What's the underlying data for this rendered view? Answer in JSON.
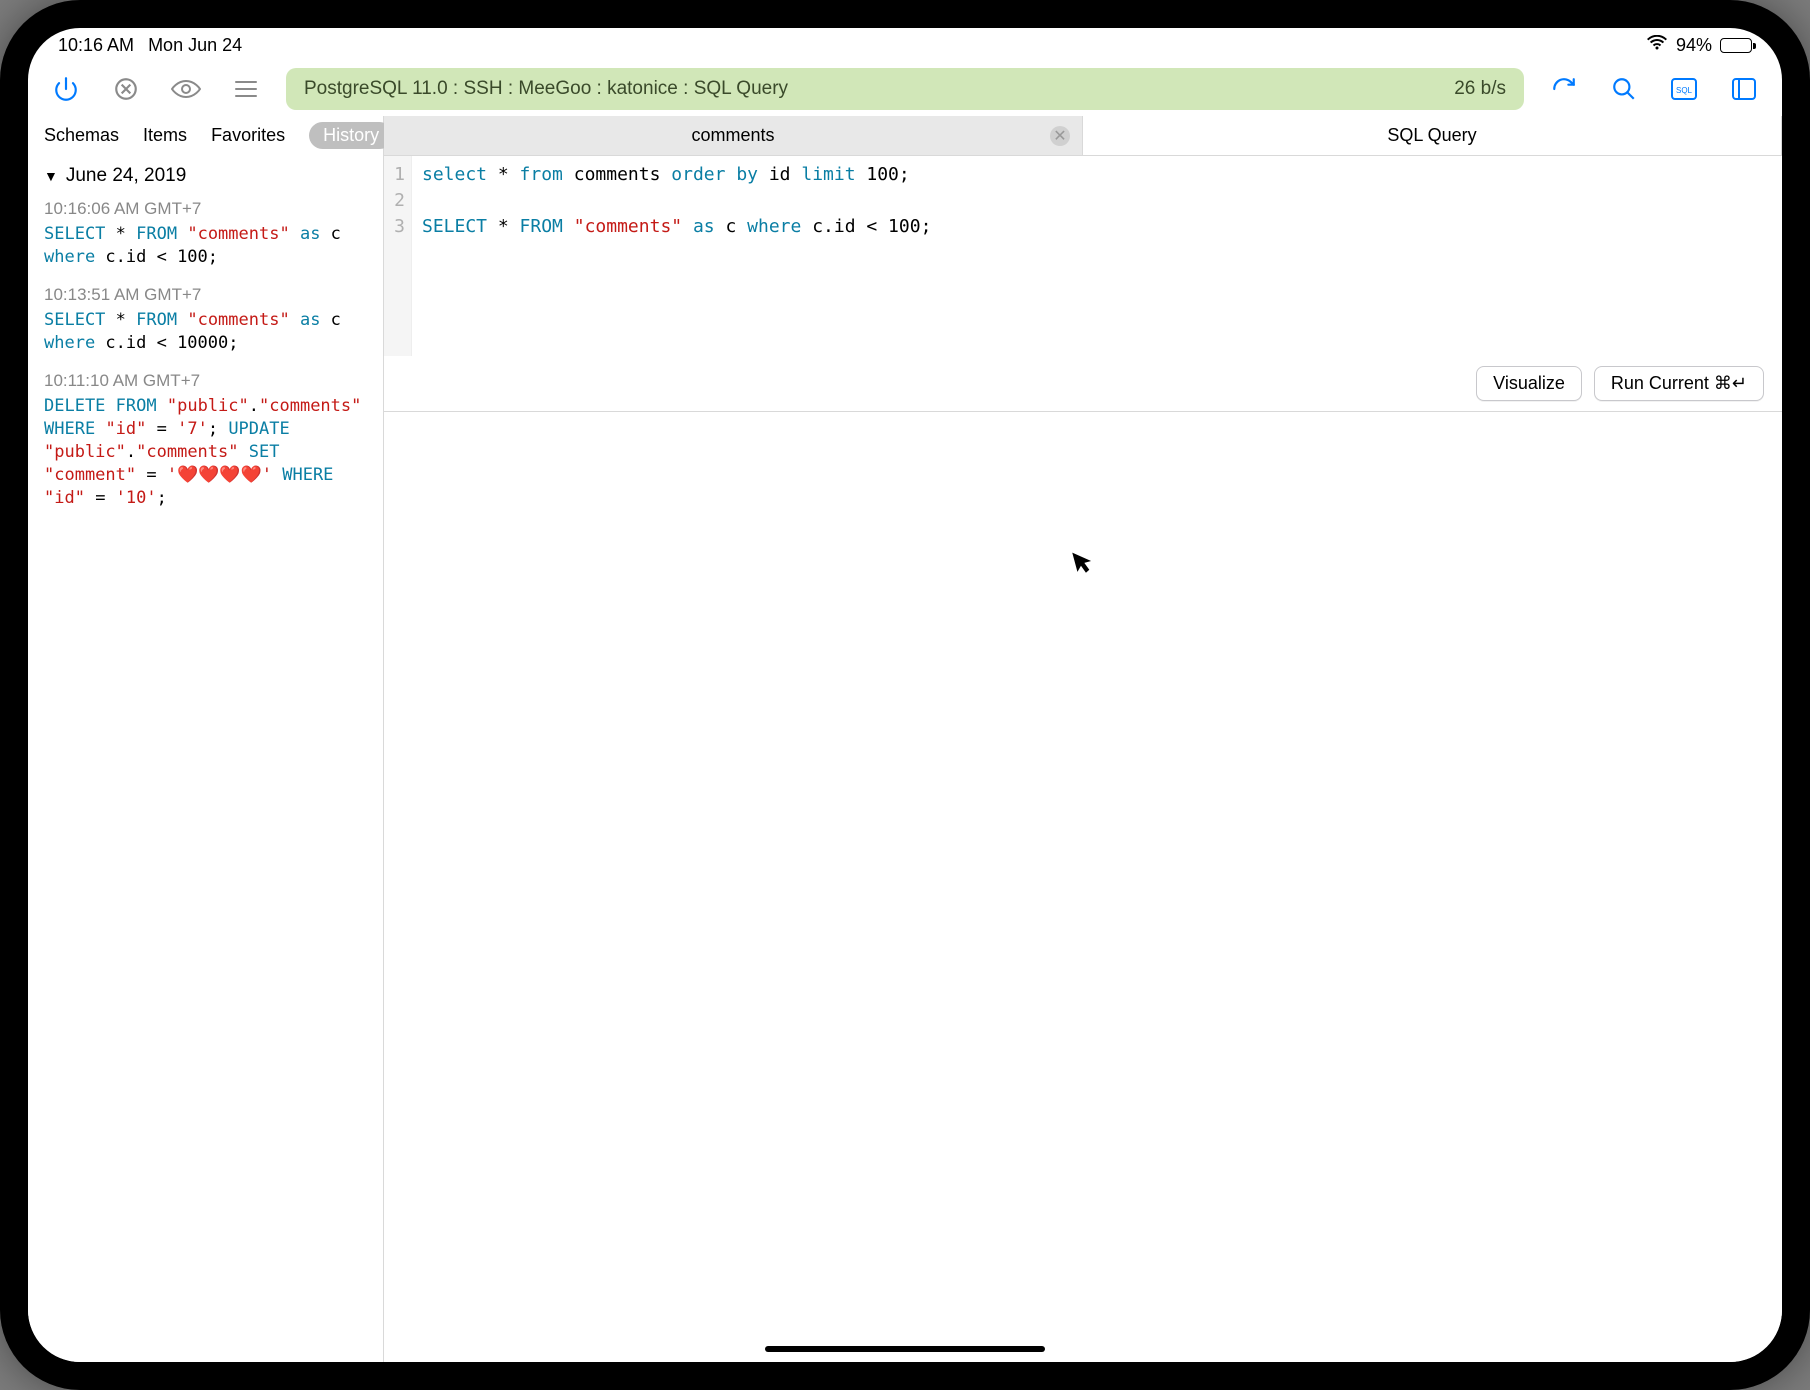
{
  "status": {
    "time": "10:16 AM",
    "date": "Mon Jun 24",
    "battery_pct": "94%"
  },
  "toolbar": {
    "connection": "PostgreSQL 11.0 : SSH : MeeGoo : katonice : SQL Query",
    "speed": "26 b/s"
  },
  "sidebar": {
    "tabs": {
      "schemas": "Schemas",
      "items": "Items",
      "favorites": "Favorites",
      "history": "History"
    },
    "group_date": "June 24, 2019",
    "entries": [
      {
        "time": "10:16:06 AM GMT+7"
      },
      {
        "time": "10:13:51 AM GMT+7"
      },
      {
        "time": "10:11:10 AM GMT+7"
      }
    ],
    "sql1": {
      "a": "SELECT",
      "b": " * ",
      "c": "FROM",
      "d": " ",
      "e": "\"comments\"",
      "f": " ",
      "g": "as",
      "h": " c ",
      "i": "where",
      "j": " c.id < 100;"
    },
    "sql2": {
      "a": "SELECT",
      "b": " * ",
      "c": "FROM",
      "d": " ",
      "e": "\"comments\"",
      "f": " ",
      "g": "as",
      "h": " c ",
      "i": "where",
      "j": " c.id < 10000;"
    },
    "sql3": {
      "a": "DELETE",
      "b": " ",
      "c": "FROM",
      "d": " ",
      "e": "\"public\"",
      "f": ".",
      "g": "\"comments\"",
      "h": " ",
      "i": "WHERE",
      "j": " ",
      "k": "\"id\"",
      "l": " = ",
      "m": "'7'",
      "n": "; ",
      "o": "UPDATE",
      "p": " ",
      "q": "\"public\"",
      "r": ".",
      "s": "\"comments\"",
      "t": " ",
      "u": "SET",
      "v": " ",
      "w": "\"comment\"",
      "x": " = ",
      "y": "'❤️❤️❤️❤️'",
      "z": " ",
      "aa": "WHERE",
      "ab": " ",
      "ac": "\"id\"",
      "ad": " = ",
      "ae": "'10'",
      "af": ";"
    }
  },
  "doc_tabs": {
    "t1": "comments",
    "t2": "SQL Query"
  },
  "editor": {
    "ln1": "1",
    "ln2": "2",
    "ln3": "3",
    "l1": {
      "a": "select",
      "b": " * ",
      "c": "from",
      "d": " comments ",
      "e": "order",
      "f": " ",
      "g": "by",
      "h": " id ",
      "i": "limit",
      "j": " 100;"
    },
    "l3": {
      "a": "SELECT",
      "b": " * ",
      "c": "FROM",
      "d": " ",
      "e": "\"comments\"",
      "f": " ",
      "g": "as",
      "h": " c ",
      "i": "where",
      "j": " c.id < 100;"
    }
  },
  "actions": {
    "visualize": "Visualize",
    "run": "Run Current ⌘↵"
  }
}
